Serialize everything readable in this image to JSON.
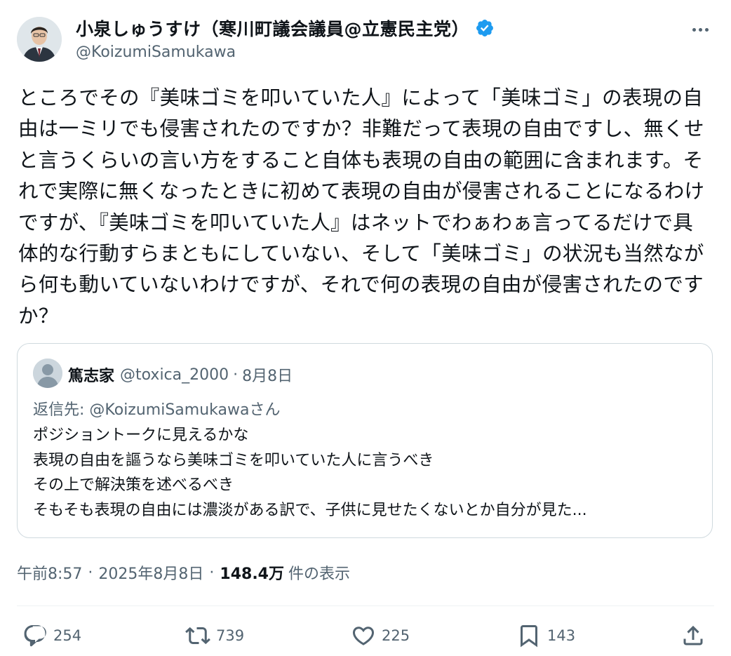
{
  "author": {
    "display_name": "小泉しゅうすけ（寒川町議会議員@立憲民主党）",
    "handle": "@KoizumiSamukawa",
    "verified_color": "#1d9bf0"
  },
  "tweet": {
    "text": "ところでその『美味ゴミを叩いていた人』によって「美味ゴミ」の表現の自由は一ミリでも侵害されたのですか？非難だって表現の自由ですし、無くせと言うくらいの言い方をすること自体も表現の自由の範囲に含まれます。それで実際に無くなったときに初めて表現の自由が侵害されることになるわけですが、『美味ゴミを叩いていた人』はネットでわぁわぁ言ってるだけで具体的な行動すらまともにしていない、そして「美味ゴミ」の状況も当然ながら何も動いていないわけですが、それで何の表現の自由が侵害されたのですか？"
  },
  "quote": {
    "name": "篤志家",
    "handle": "@toxica_2000",
    "dot": "·",
    "date": "8月8日",
    "reply_prefix": "返信先: ",
    "reply_to": "@KoizumiSamukawa",
    "reply_suffix": "さん",
    "lines": [
      "ポジショントークに見えるかな",
      "表現の自由を謳うなら美味ゴミを叩いていた人に言うべき",
      "その上で解決策を述べるべき",
      "そもそも表現の自由には濃淡がある訳で、子供に見せたくないとか自分が見た..."
    ]
  },
  "meta": {
    "time": "午前8:57",
    "sep": "·",
    "date": "2025年8月8日",
    "views": "148.4万",
    "views_label": "件の表示"
  },
  "actions": {
    "reply": {
      "icon": "reply-icon",
      "count": "254"
    },
    "retweet": {
      "icon": "retweet-icon",
      "count": "739"
    },
    "like": {
      "icon": "heart-icon",
      "count": "225"
    },
    "bookmark": {
      "icon": "bookmark-icon",
      "count": "143"
    },
    "share": {
      "icon": "share-icon"
    }
  },
  "colors": {
    "text": "#0f1419",
    "secondary": "#536471",
    "border": "#cfd9de",
    "accent": "#1d9bf0"
  }
}
